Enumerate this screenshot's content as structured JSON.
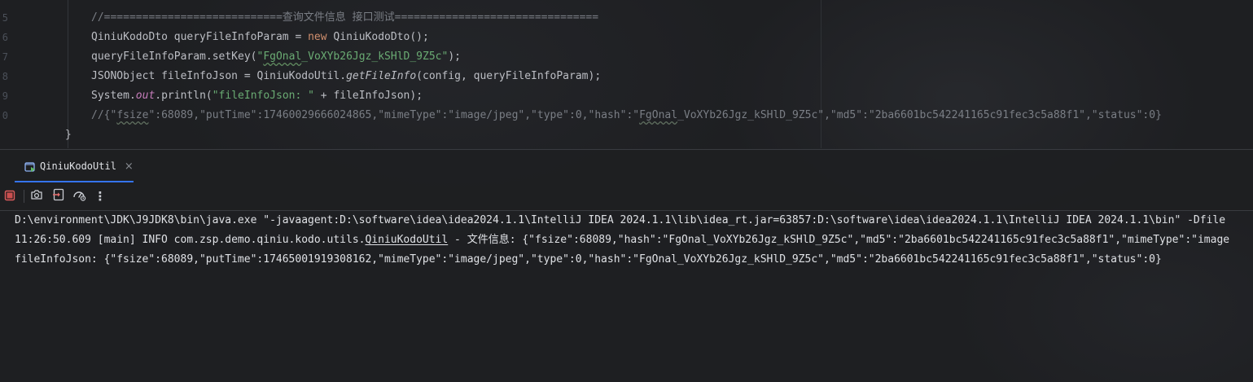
{
  "editor": {
    "line_numbers": [
      "5",
      "6",
      "7",
      "8",
      "9",
      "0"
    ],
    "lines": {
      "l1_comment": "//============================查询文件信息 接口测试================================",
      "l2_type": "QiniuKodoDto queryFileInfoParam = ",
      "l2_new": "new",
      "l2_rest": " QiniuKodoDto();",
      "l3_start": "queryFileInfoParam.setKey(",
      "l3_str_pre": "\"",
      "l3_str_sq": "FgOnal",
      "l3_str_post": "_VoXYb26Jgz_kSHlD_9Z5c\"",
      "l3_end": ");",
      "l4_start": "JSONObject fileInfoJson = QiniuKodoUtil.",
      "l4_method": "getFileInfo",
      "l4_end": "(config, queryFileInfoParam);",
      "l5_start": "System.",
      "l5_out": "out",
      "l5_mid": ".println(",
      "l5_str": "\"fileInfoJson: \"",
      "l5_end": " + fileInfoJson);",
      "l6_pre": "//{\"",
      "l6_sq1": "fsize",
      "l6_mid": "\":68089,\"putTime\":17460029666024865,\"mimeType\":\"image/jpeg\",\"type\":0,\"hash\":\"",
      "l6_sq2": "FgOnal",
      "l6_end": "_VoXYb26Jgz_kSHlD_9Z5c\",\"md5\":\"2ba6601bc542241165c91fec3c5a88f1\",\"status\":0}",
      "l7_brace": "}"
    }
  },
  "run_tab": {
    "label": "QiniuKodoUtil",
    "close": "×",
    "icon": "run-config-icon"
  },
  "toolbar": {
    "buttons": [
      "stop-icon",
      "camera-icon",
      "restore-layout-icon",
      "performance-icon",
      "more-icon"
    ],
    "more_label": "⋮"
  },
  "console": {
    "line1": "D:\\environment\\JDK\\J9JDK8\\bin\\java.exe \"-javaagent:D:\\software\\idea\\idea2024.1.1\\IntelliJ IDEA 2024.1.1\\lib\\idea_rt.jar=63857:D:\\software\\idea\\idea2024.1.1\\IntelliJ IDEA 2024.1.1\\bin\" -Dfile",
    "line2_pre": "11:26:50.609 [main] INFO com.zsp.demo.qiniu.kodo.utils.",
    "line2_link": "QiniuKodoUtil",
    "line2_post": " - 文件信息: {\"fsize\":68089,\"hash\":\"FgOnal_VoXYb26Jgz_kSHlD_9Z5c\",\"md5\":\"2ba6601bc542241165c91fec3c5a88f1\",\"mimeType\":\"image",
    "line3": "fileInfoJson: {\"fsize\":68089,\"putTime\":17465001919308162,\"mimeType\":\"image/jpeg\",\"type\":0,\"hash\":\"FgOnal_VoXYb26Jgz_kSHlD_9Z5c\",\"md5\":\"2ba6601bc542241165c91fec3c5a88f1\",\"status\":0}"
  },
  "colors": {
    "background": "#1e1f22",
    "keyword": "#cf8e6d",
    "string": "#6aab73",
    "comment": "#7a7e85",
    "static_field": "#c77dbb",
    "text": "#bcbec4",
    "console_text": "#dfe1e5",
    "accent": "#3574f0",
    "stop": "#db5c5c"
  }
}
